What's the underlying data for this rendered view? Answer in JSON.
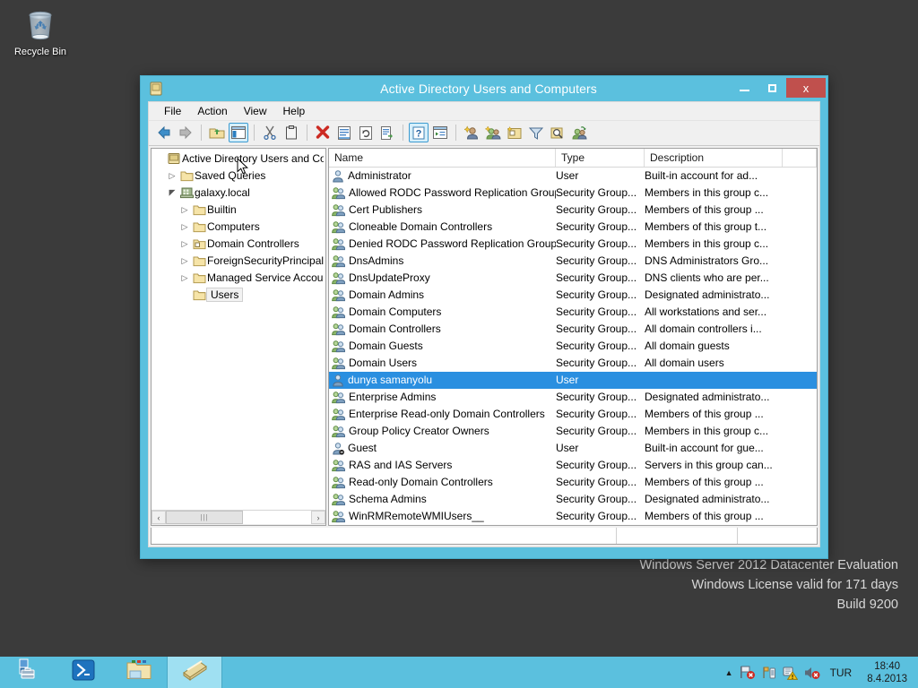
{
  "desktop": {
    "recycle_bin": {
      "label": "Recycle Bin",
      "icon": "recycle-bin-icon"
    },
    "watermark": {
      "line1": "Windows Server 2012 Datacenter Evaluation",
      "line2": "Windows License valid for 171 days",
      "line3": "Build 9200"
    }
  },
  "window": {
    "title": "Active Directory Users and Computers",
    "icon": "console-icon",
    "controls": {
      "minimize": "minimize-button",
      "maximize": "maximize-button",
      "close_label": "x"
    },
    "menu": [
      {
        "label": "File"
      },
      {
        "label": "Action"
      },
      {
        "label": "View"
      },
      {
        "label": "Help"
      }
    ],
    "toolbar": [
      {
        "name": "back-icon",
        "glyph": "back"
      },
      {
        "name": "forward-icon",
        "glyph": "forward"
      },
      {
        "sep": true
      },
      {
        "name": "up-one-level-icon",
        "glyph": "upfolder"
      },
      {
        "name": "show-hide-tree-icon",
        "glyph": "treepane",
        "selected": true
      },
      {
        "sep": true
      },
      {
        "name": "cut-icon",
        "glyph": "cut"
      },
      {
        "name": "copy-icon",
        "glyph": "clipboard"
      },
      {
        "sep": true
      },
      {
        "name": "delete-icon",
        "glyph": "delete"
      },
      {
        "name": "properties-icon",
        "glyph": "properties"
      },
      {
        "name": "refresh-icon",
        "glyph": "refresh"
      },
      {
        "name": "export-list-icon",
        "glyph": "export"
      },
      {
        "sep": true
      },
      {
        "name": "help-icon",
        "glyph": "help",
        "selected": true
      },
      {
        "name": "show-console-tree-icon",
        "glyph": "console"
      },
      {
        "sep": true
      },
      {
        "name": "new-user-icon",
        "glyph": "newuser"
      },
      {
        "name": "new-group-icon",
        "glyph": "newgroup"
      },
      {
        "name": "new-organizational-unit-icon",
        "glyph": "newou"
      },
      {
        "name": "filter-icon",
        "glyph": "filter"
      },
      {
        "name": "find-icon",
        "glyph": "find"
      },
      {
        "name": "user-action-icon",
        "glyph": "useraction"
      }
    ]
  },
  "tree": {
    "nodes": [
      {
        "label": "Active Directory Users and Com",
        "indent": 0,
        "expander": "",
        "icon": "console-root-icon",
        "selected": false
      },
      {
        "label": "Saved Queries",
        "indent": 1,
        "expander": "collapsed",
        "icon": "folder-icon",
        "selected": false
      },
      {
        "label": "galaxy.local",
        "indent": 1,
        "expander": "expanded",
        "icon": "domain-icon",
        "selected": false
      },
      {
        "label": "Builtin",
        "indent": 2,
        "expander": "collapsed",
        "icon": "folder-icon",
        "selected": false
      },
      {
        "label": "Computers",
        "indent": 2,
        "expander": "collapsed",
        "icon": "folder-icon",
        "selected": false
      },
      {
        "label": "Domain Controllers",
        "indent": 2,
        "expander": "collapsed",
        "icon": "ou-folder-icon",
        "selected": false
      },
      {
        "label": "ForeignSecurityPrincipals",
        "indent": 2,
        "expander": "collapsed",
        "icon": "folder-icon",
        "selected": false
      },
      {
        "label": "Managed Service Accoun",
        "indent": 2,
        "expander": "collapsed",
        "icon": "folder-icon",
        "selected": false
      },
      {
        "label": "Users",
        "indent": 2,
        "expander": "",
        "icon": "folder-icon",
        "selected": true
      }
    ],
    "hscroll": {
      "left_arrow": "‹",
      "right_arrow": "›",
      "grip": "|||"
    }
  },
  "list": {
    "columns": [
      {
        "label": "Name"
      },
      {
        "label": "Type"
      },
      {
        "label": "Description"
      },
      {
        "label": ""
      }
    ],
    "rows": [
      {
        "icon": "user-icon",
        "name": "Administrator",
        "type": "User",
        "description": "Built-in account for ad...",
        "selected": false
      },
      {
        "icon": "group-icon",
        "name": "Allowed RODC Password Replication Group",
        "type": "Security Group...",
        "description": "Members in this group c...",
        "selected": false
      },
      {
        "icon": "group-icon",
        "name": "Cert Publishers",
        "type": "Security Group...",
        "description": "Members of this group ...",
        "selected": false
      },
      {
        "icon": "group-icon",
        "name": "Cloneable Domain Controllers",
        "type": "Security Group...",
        "description": "Members of this group t...",
        "selected": false
      },
      {
        "icon": "group-icon",
        "name": "Denied RODC Password Replication Group",
        "type": "Security Group...",
        "description": "Members in this group c...",
        "selected": false
      },
      {
        "icon": "group-icon",
        "name": "DnsAdmins",
        "type": "Security Group...",
        "description": "DNS Administrators Gro...",
        "selected": false
      },
      {
        "icon": "group-icon",
        "name": "DnsUpdateProxy",
        "type": "Security Group...",
        "description": "DNS clients who are per...",
        "selected": false
      },
      {
        "icon": "group-icon",
        "name": "Domain Admins",
        "type": "Security Group...",
        "description": "Designated administrato...",
        "selected": false
      },
      {
        "icon": "group-icon",
        "name": "Domain Computers",
        "type": "Security Group...",
        "description": "All workstations and ser...",
        "selected": false
      },
      {
        "icon": "group-icon",
        "name": "Domain Controllers",
        "type": "Security Group...",
        "description": "All domain controllers i...",
        "selected": false
      },
      {
        "icon": "group-icon",
        "name": "Domain Guests",
        "type": "Security Group...",
        "description": "All domain guests",
        "selected": false
      },
      {
        "icon": "group-icon",
        "name": "Domain Users",
        "type": "Security Group...",
        "description": "All domain users",
        "selected": false
      },
      {
        "icon": "user-icon",
        "name": "dunya samanyolu",
        "type": "User",
        "description": "",
        "selected": true
      },
      {
        "icon": "group-icon",
        "name": "Enterprise Admins",
        "type": "Security Group...",
        "description": "Designated administrato...",
        "selected": false
      },
      {
        "icon": "group-icon",
        "name": "Enterprise Read-only Domain Controllers",
        "type": "Security Group...",
        "description": "Members of this group ...",
        "selected": false
      },
      {
        "icon": "group-icon",
        "name": "Group Policy Creator Owners",
        "type": "Security Group...",
        "description": "Members in this group c...",
        "selected": false
      },
      {
        "icon": "user-disabled-icon",
        "name": "Guest",
        "type": "User",
        "description": "Built-in account for gue...",
        "selected": false
      },
      {
        "icon": "group-icon",
        "name": "RAS and IAS Servers",
        "type": "Security Group...",
        "description": "Servers in this group can...",
        "selected": false
      },
      {
        "icon": "group-icon",
        "name": "Read-only Domain Controllers",
        "type": "Security Group...",
        "description": "Members of this group ...",
        "selected": false
      },
      {
        "icon": "group-icon",
        "name": "Schema Admins",
        "type": "Security Group...",
        "description": "Designated administrato...",
        "selected": false
      },
      {
        "icon": "group-icon",
        "name": "WinRMRemoteWMIUsers__",
        "type": "Security Group...",
        "description": "Members of this group ...",
        "selected": false
      }
    ]
  },
  "statusbar": {
    "text": ""
  },
  "taskbar": {
    "buttons": [
      {
        "name": "server-manager-button",
        "icon": "server-manager-icon",
        "active": false
      },
      {
        "name": "powershell-button",
        "icon": "powershell-icon",
        "active": false
      },
      {
        "name": "file-explorer-button",
        "icon": "file-explorer-icon",
        "active": false
      },
      {
        "name": "active-directory-window-button",
        "icon": "ad-users-computers-icon",
        "active": true
      }
    ],
    "tray": {
      "show_hidden": "▲",
      "icons": [
        {
          "name": "network-error-icon"
        },
        {
          "name": "flag-action-center-icon"
        },
        {
          "name": "action-center-warning-icon"
        },
        {
          "name": "volume-muted-icon"
        }
      ],
      "language": "TUR",
      "time": "18:40",
      "date": "8.4.2013"
    }
  },
  "colors": {
    "accent": "#5bc0de",
    "selection": "#2a8fe0",
    "close_button": "#c0504d",
    "desktop": "#3b3b3b"
  }
}
